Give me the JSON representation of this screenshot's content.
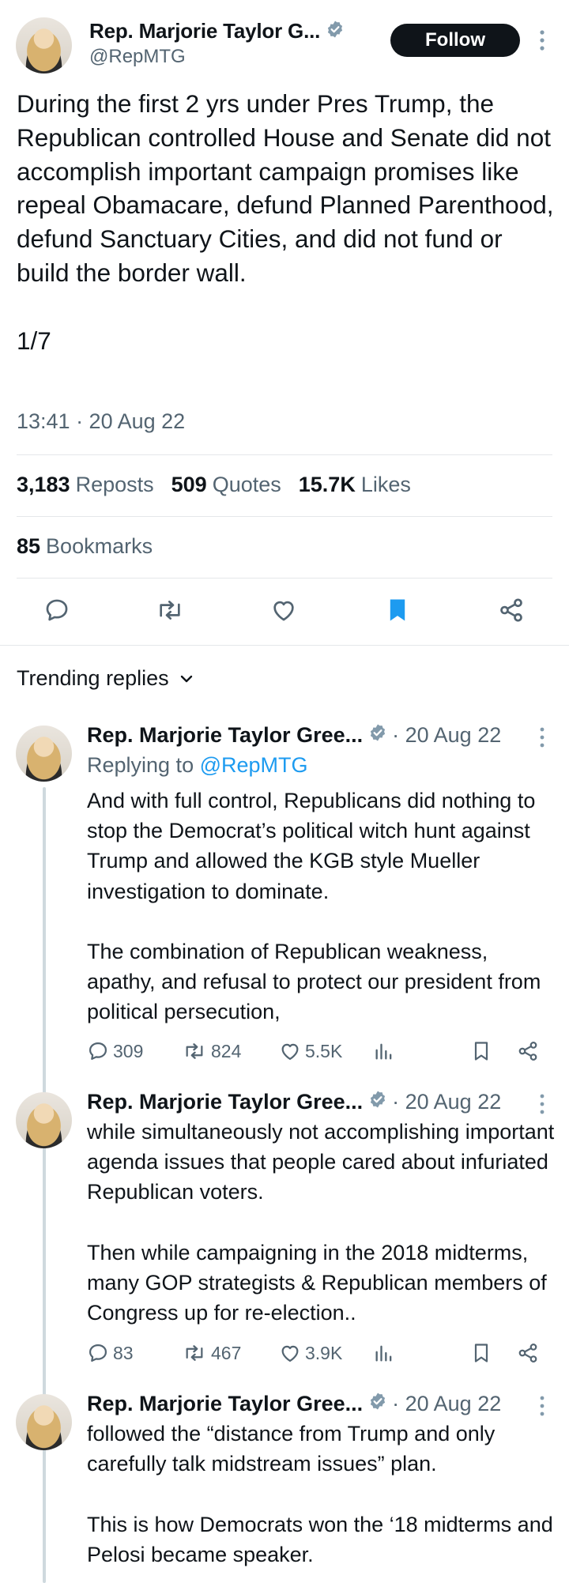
{
  "main_tweet": {
    "name": "Rep. Marjorie Taylor G...",
    "handle": "@RepMTG",
    "follow_label": "Follow",
    "text": "During the first 2 yrs under Pres Trump, the Republican controlled House and Senate did not accomplish important campaign promises like repeal Obamacare, defund Planned Parenthood, defund Sanctuary Cities, and did not fund or build the border wall.\n\n1/7",
    "timestamp": "13:41 · 20 Aug 22",
    "stats": {
      "reposts_count": "3,183",
      "reposts_label": "Reposts",
      "quotes_count": "509",
      "quotes_label": "Quotes",
      "likes_count": "15.7K",
      "likes_label": "Likes"
    },
    "bookmarks": {
      "count": "85",
      "label": "Bookmarks"
    }
  },
  "trending": {
    "label": "Trending replies"
  },
  "replies": [
    {
      "name": "Rep. Marjorie Taylor Gree...",
      "date": "· 20 Aug 22",
      "replying_prefix": "Replying to",
      "replying_handle": "@RepMTG",
      "text": "And with full control, Republicans did nothing to stop the Democrat’s political witch hunt against Trump and allowed the KGB style Mueller investigation to dominate.\n\nThe combination of Republican weakness, apathy, and refusal to protect our president from political persecution,",
      "replies": "309",
      "reposts": "824",
      "likes": "5.5K"
    },
    {
      "name": "Rep. Marjorie Taylor Gree...",
      "date": "· 20 Aug 22",
      "text": "while simultaneously not accomplishing important agenda issues that people cared about infuriated Republican voters.\n\nThen while campaigning in the 2018 midterms, many GOP strategists & Republican members of Congress up for re-election..",
      "replies": "83",
      "reposts": "467",
      "likes": "3.9K"
    },
    {
      "name": "Rep. Marjorie Taylor Gree...",
      "date": "· 20 Aug 22",
      "text": "followed the “distance from Trump and only carefully talk midstream issues” plan.\n\nThis is how Democrats won the ‘18 midterms and Pelosi became speaker."
    }
  ],
  "colors": {
    "accent": "#1d9bf0",
    "text": "#0f1419",
    "muted": "#536471",
    "verified": "#829aab"
  },
  "icons": [
    "verified-badge-icon",
    "more-icon",
    "reply-icon",
    "repost-icon",
    "like-icon",
    "bookmark-icon",
    "share-icon",
    "views-icon",
    "chevron-down-icon"
  ]
}
